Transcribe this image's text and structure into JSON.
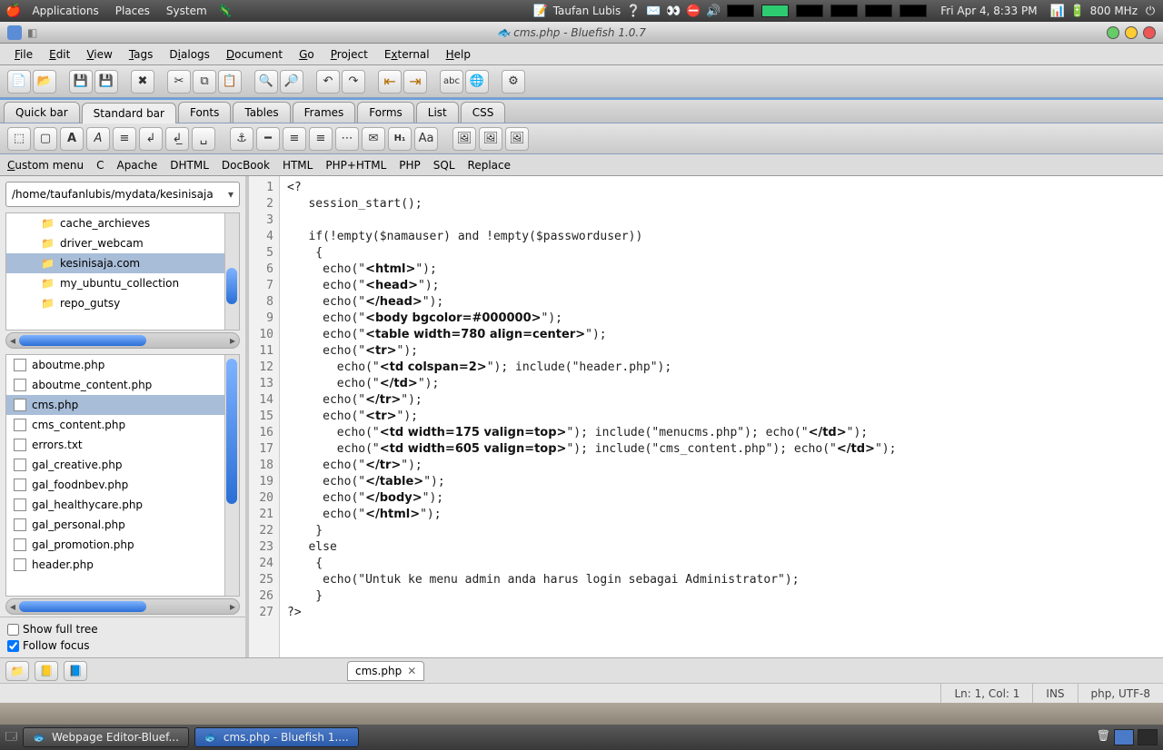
{
  "gnome": {
    "menus": [
      "Applications",
      "Places",
      "System"
    ],
    "user": "Taufan Lubis",
    "clock": "Fri Apr  4,  8:33 PM",
    "cpu": "800 MHz"
  },
  "window": {
    "title": "cms.php - Bluefish 1.0.7"
  },
  "menubar": [
    "File",
    "Edit",
    "View",
    "Tags",
    "Dialogs",
    "Document",
    "Go",
    "Project",
    "External",
    "Help"
  ],
  "tabs": [
    "Quick bar",
    "Standard bar",
    "Fonts",
    "Tables",
    "Frames",
    "Forms",
    "List",
    "CSS"
  ],
  "active_tab": "Standard bar",
  "submenu": [
    "Custom menu",
    "C",
    "Apache",
    "DHTML",
    "DocBook",
    "HTML",
    "PHP+HTML",
    "PHP",
    "SQL",
    "Replace"
  ],
  "path": "/home/taufanlubis/mydata/kesinisaja",
  "tree": [
    {
      "label": "cache_archieves",
      "sel": false
    },
    {
      "label": "driver_webcam",
      "sel": false
    },
    {
      "label": "kesinisaja.com",
      "sel": true
    },
    {
      "label": "my_ubuntu_collection",
      "sel": false
    },
    {
      "label": "repo_gutsy",
      "sel": false
    }
  ],
  "files": [
    "aboutme.php",
    "aboutme_content.php",
    "cms.php",
    "cms_content.php",
    "errors.txt",
    "gal_creative.php",
    "gal_foodnbev.php",
    "gal_healthycare.php",
    "gal_personal.php",
    "gal_promotion.php",
    "header.php"
  ],
  "selected_file": "cms.php",
  "opts": {
    "show_full_tree_label": "Show full tree",
    "show_full_tree": false,
    "follow_focus_label": "Follow focus",
    "follow_focus": true
  },
  "doc_tab": "cms.php",
  "status": {
    "pos": "Ln: 1, Col: 1",
    "ins": "INS",
    "enc": "php, UTF-8"
  },
  "taskbar": [
    {
      "label": "Webpage Editor-Bluef...",
      "active": false
    },
    {
      "label": "cms.php - Bluefish 1....",
      "active": true
    }
  ],
  "code_lines": [
    "<?",
    "   session_start();",
    "",
    "   if(!empty($namauser) and !empty($passworduser))",
    "    {",
    "     echo(\"<html>\");",
    "     echo(\"<head>\");",
    "     echo(\"</head>\");",
    "     echo(\"<body bgcolor=#000000>\");",
    "     echo(\"<table width=780 align=center>\");",
    "     echo(\"<tr>\");",
    "       echo(\"<td colspan=2>\"); include(\"header.php\");",
    "       echo(\"</td>\");",
    "     echo(\"</tr>\");",
    "     echo(\"<tr>\");",
    "       echo(\"<td width=175 valign=top>\"); include(\"menucms.php\"); echo(\"</td>\");",
    "       echo(\"<td width=605 valign=top>\"); include(\"cms_content.php\"); echo(\"</td>\");",
    "     echo(\"</tr>\");",
    "     echo(\"</table>\");",
    "     echo(\"</body>\");",
    "     echo(\"</html>\");",
    "    }",
    "   else",
    "    {",
    "     echo(\"Untuk ke menu admin anda harus login sebagai Administrator\");",
    "    }",
    "?>"
  ]
}
